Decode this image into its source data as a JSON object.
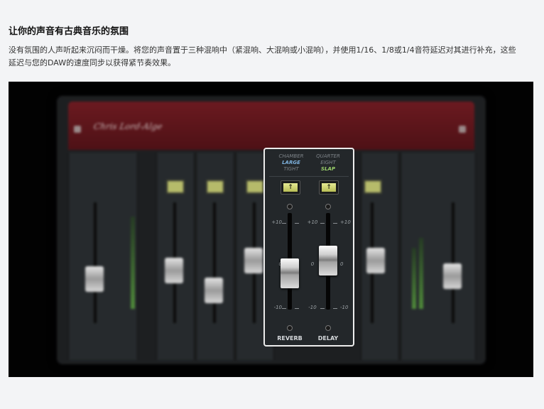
{
  "section": {
    "heading": "让你的声音有古典音乐的氛围",
    "description": "没有氛围的人声听起来沉闷而干燥。将您的声音置于三种混响中（紧混响、大混响或小混响），并使用1/16、1/8或1/4音符延迟对其进行补充，这些延迟与您的DAW的速度同步以获得紧节奏效果。"
  },
  "plugin": {
    "brand": "Chris Lord-Alge",
    "reverb": {
      "modes": [
        "CHAMBER",
        "LARGE",
        "TIGHT"
      ],
      "active_mode": "LARGE",
      "label": "REVERB",
      "fader_level_db": -2,
      "toggle_icon": "↑"
    },
    "delay": {
      "modes": [
        "QUARTER",
        "EIGHT",
        "SLAP"
      ],
      "active_mode": "SLAP",
      "label": "DELAY",
      "fader_level_db": 1,
      "toggle_icon": "↑"
    },
    "scale_marks": [
      "+10",
      "0",
      "-10"
    ],
    "colors": {
      "active_reverb": "#7fb4e0",
      "active_delay": "#9bd06b",
      "inactive": "#7d8388",
      "highlight_border": "#ececec",
      "header_red": "#6b1a20"
    }
  }
}
